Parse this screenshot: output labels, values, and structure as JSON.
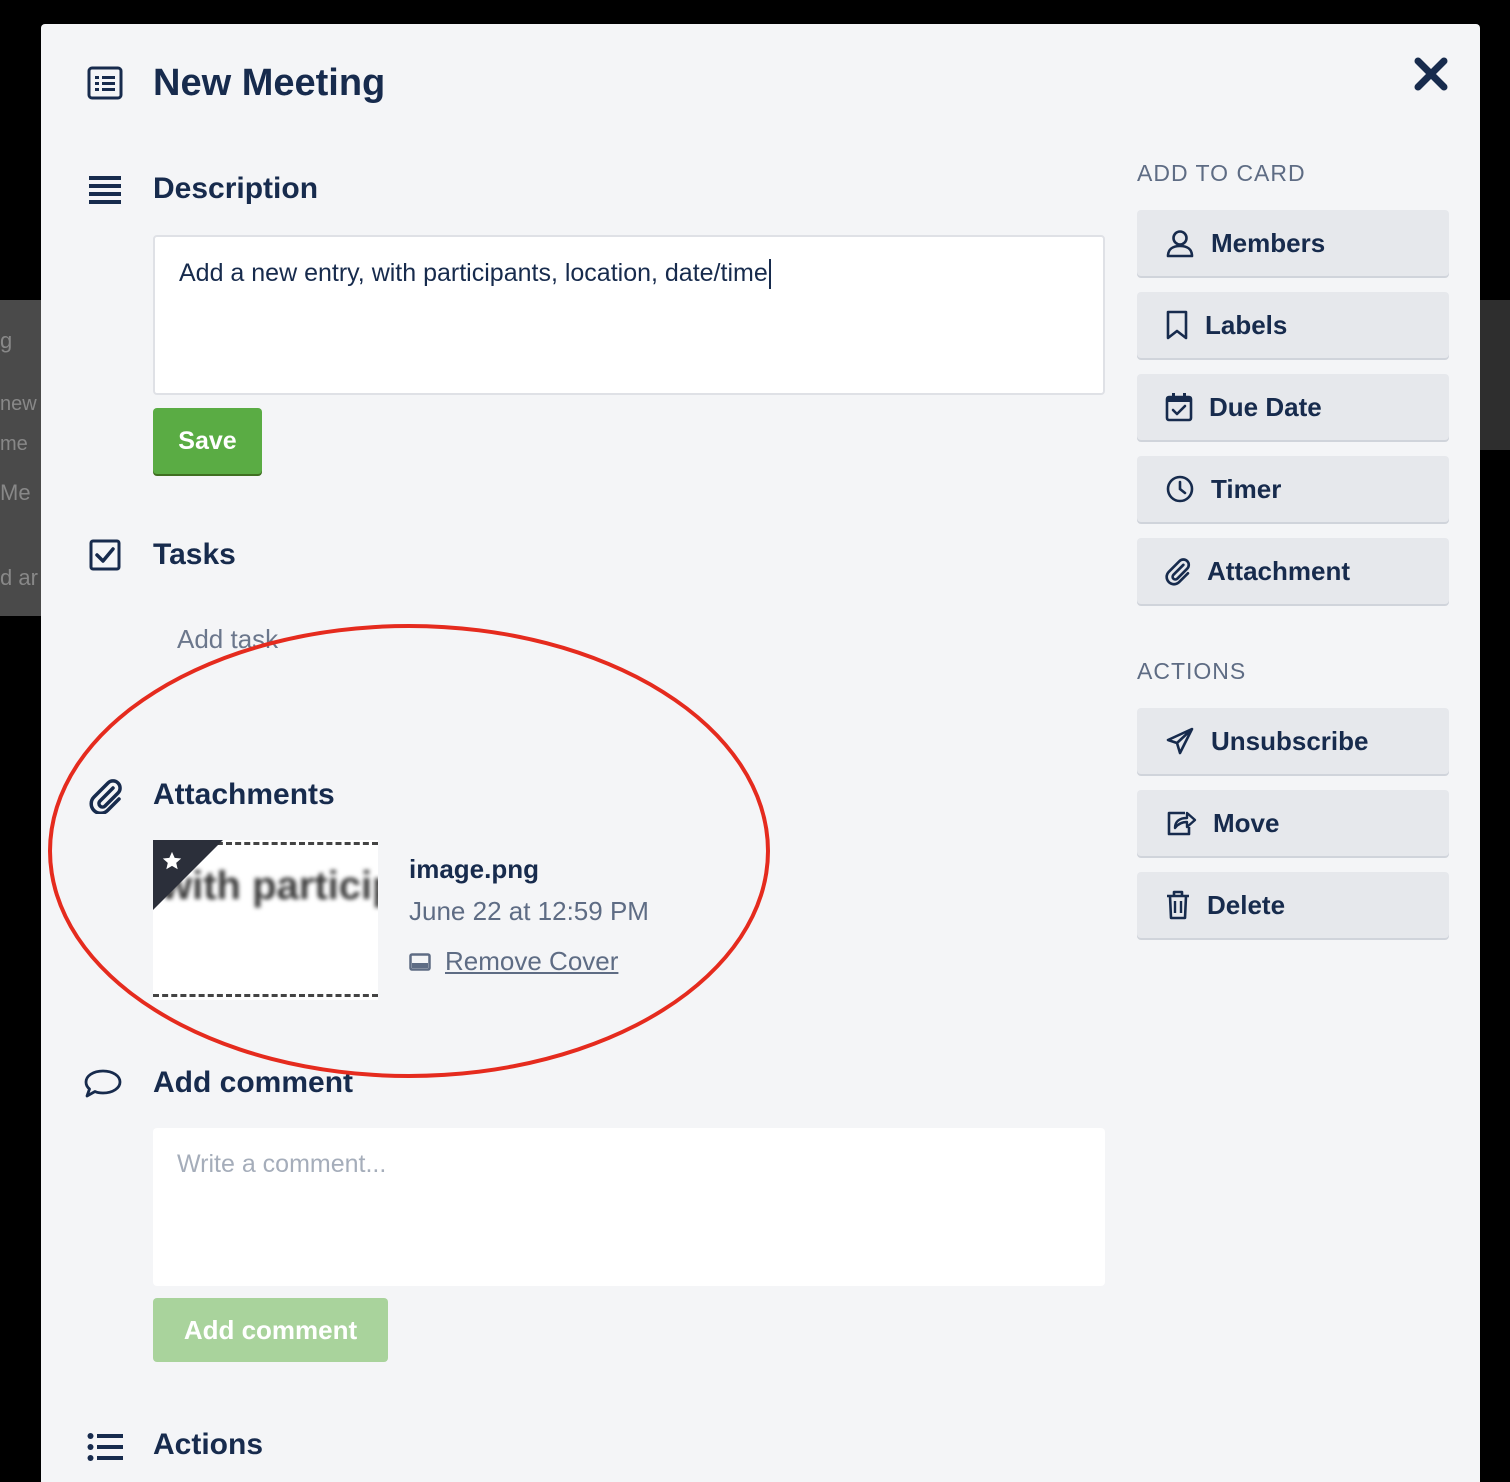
{
  "background": {
    "fragments": [
      "g",
      "new",
      "me",
      "Me",
      "d ar"
    ]
  },
  "card": {
    "title": "New Meeting",
    "close_icon": "close-icon"
  },
  "description": {
    "heading": "Description",
    "text": "Add a new entry, with participants, location, date/time",
    "save_label": "Save"
  },
  "tasks": {
    "heading": "Tasks",
    "add_task": "Add task"
  },
  "attachments": {
    "heading": "Attachments",
    "thumb_text": "with particip",
    "items": [
      {
        "name": "image.png",
        "date": "June 22 at 12:59 PM",
        "remove_cover": "Remove Cover"
      }
    ]
  },
  "comment": {
    "heading": "Add comment",
    "placeholder": "Write a comment...",
    "button_label": "Add comment"
  },
  "activity": {
    "heading": "Actions"
  },
  "sidebar": {
    "add_to_card_heading": "ADD TO CARD",
    "add_to_card": [
      {
        "label": "Members",
        "icon": "user-icon"
      },
      {
        "label": "Labels",
        "icon": "bookmark-icon"
      },
      {
        "label": "Due Date",
        "icon": "calendar-check-icon"
      },
      {
        "label": "Timer",
        "icon": "clock-icon"
      },
      {
        "label": "Attachment",
        "icon": "paperclip-icon"
      }
    ],
    "actions_heading": "ACTIONS",
    "actions": [
      {
        "label": "Unsubscribe",
        "icon": "paper-plane-icon"
      },
      {
        "label": "Move",
        "icon": "share-icon"
      },
      {
        "label": "Delete",
        "icon": "trash-icon"
      }
    ]
  },
  "colors": {
    "save_green": "#5aac44",
    "comment_green_disabled": "#a9d39c",
    "annotation_red": "#e52b1e",
    "modal_bg": "#f4f5f7"
  }
}
